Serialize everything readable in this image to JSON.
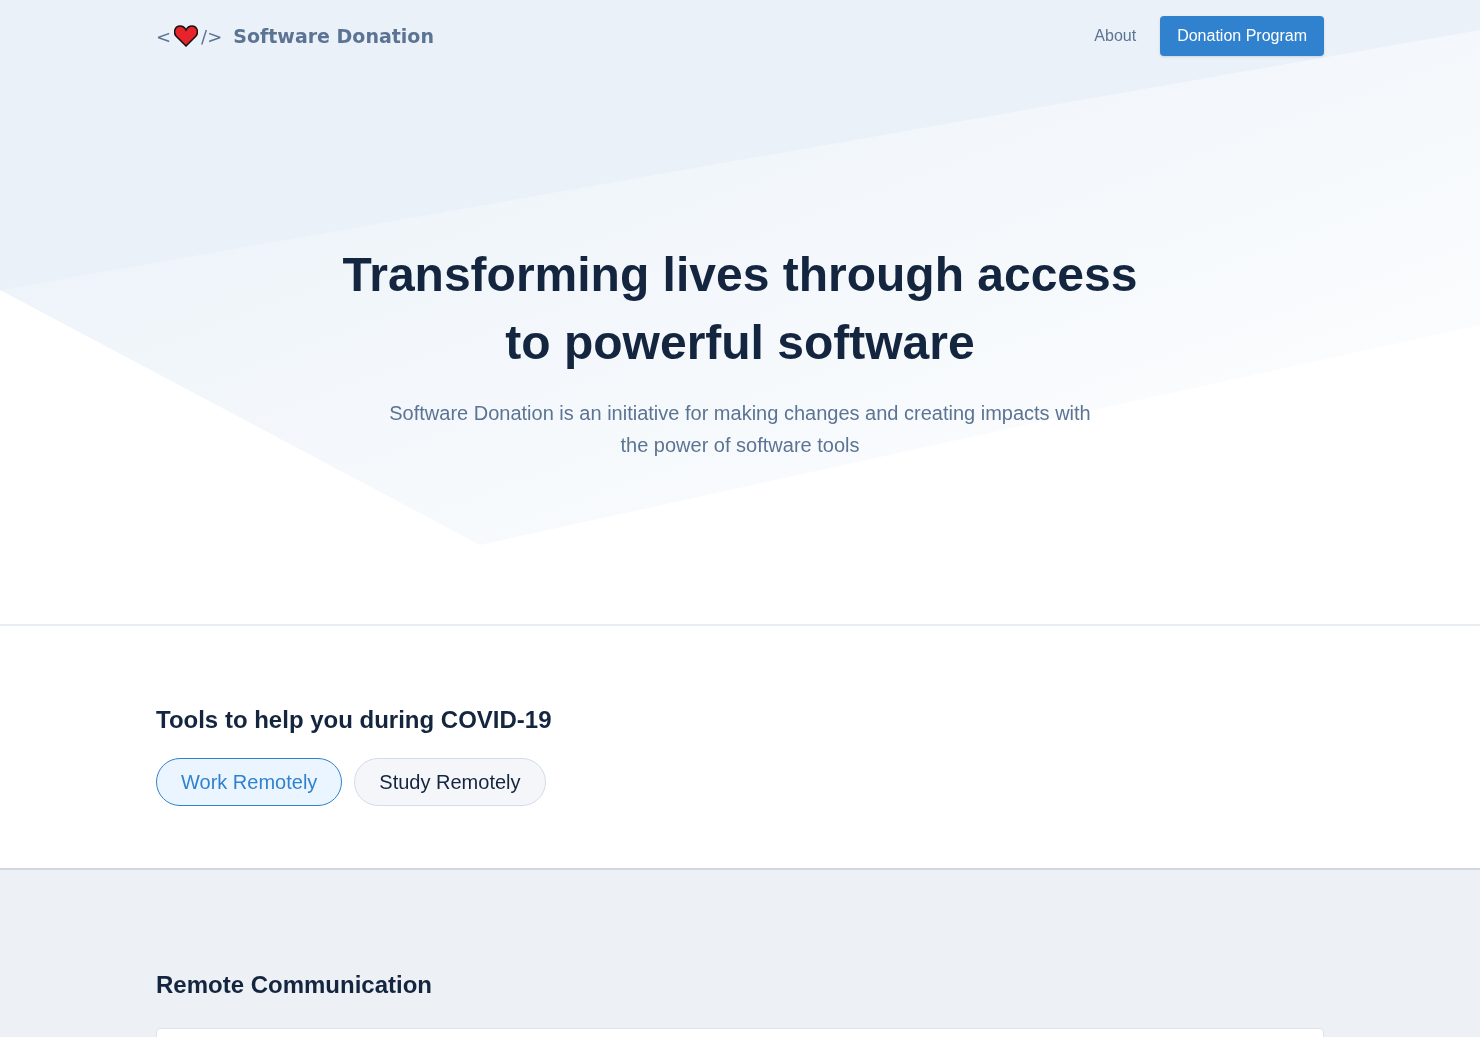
{
  "header": {
    "logo": {
      "open_bracket": "<",
      "close_bracket": "/>",
      "name": "Software Donation"
    },
    "nav": [
      {
        "label": "About",
        "kind": "link"
      },
      {
        "label": "Donation Program",
        "kind": "button"
      }
    ]
  },
  "hero": {
    "title": "Transforming lives through access to powerful software",
    "subtitle": "Software Donation is an initiative for making changes and creating impacts with the power of software tools"
  },
  "tools": {
    "heading": "Tools to help you during COVID-19",
    "tabs": [
      {
        "label": "Work Remotely",
        "selected": true
      },
      {
        "label": "Study Remotely",
        "selected": false
      }
    ]
  },
  "section": {
    "heading": "Remote Communication"
  }
}
